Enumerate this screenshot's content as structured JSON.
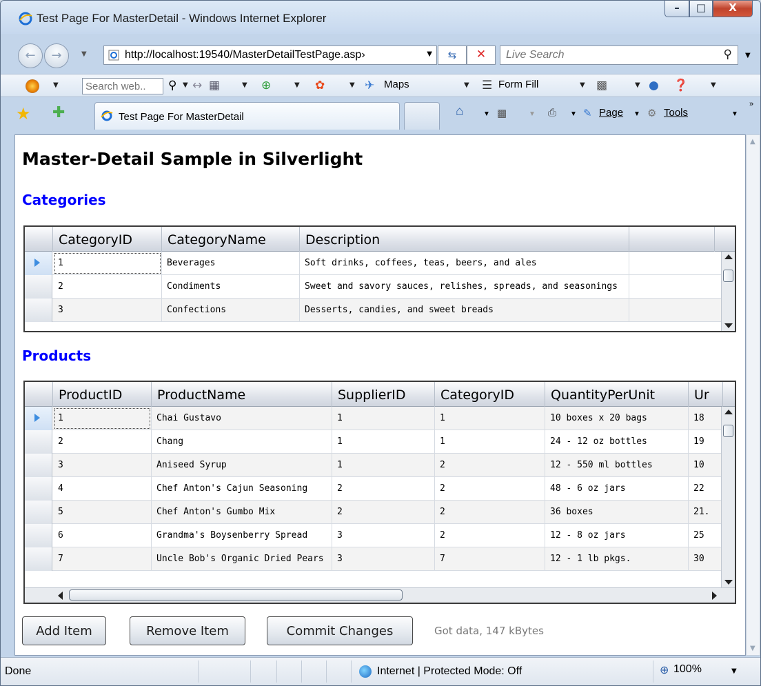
{
  "window": {
    "title": "Test Page For MasterDetail - Windows Internet Explorer",
    "min_glyph": "–",
    "max_glyph": "□",
    "close_glyph": "X"
  },
  "address": {
    "url": "http://localhost:19540/MasterDetailTestPage.asp›",
    "search_placeholder": "Live Search"
  },
  "toolbar": {
    "search_placeholder": "Search web..",
    "maps_label": "Maps",
    "formfill_label": "Form Fill"
  },
  "tabs": {
    "active_label": "Test Page For MasterDetail"
  },
  "commands": {
    "page_label": "Page",
    "tools_label": "Tools"
  },
  "page": {
    "title": "Master-Detail Sample in Silverlight",
    "categories_heading": "Categories",
    "products_heading": "Products",
    "status_text": "Got data, 147 kBytes"
  },
  "categories": {
    "columns": [
      "CategoryID",
      "CategoryName",
      "Description",
      ""
    ],
    "rows": [
      [
        "1",
        "Beverages",
        "Soft drinks, coffees, teas, beers, and ales"
      ],
      [
        "2",
        "Condiments",
        "Sweet and savory sauces, relishes, spreads, and seasonings"
      ],
      [
        "3",
        "Confections",
        "Desserts, candies, and sweet breads"
      ]
    ]
  },
  "products": {
    "columns": [
      "ProductID",
      "ProductName",
      "SupplierID",
      "CategoryID",
      "QuantityPerUnit",
      "Ur"
    ],
    "rows": [
      [
        "1",
        "Chai Gustavo",
        "1",
        "1",
        "10 boxes x 20 bags",
        "18"
      ],
      [
        "2",
        "Chang",
        "1",
        "1",
        "24 - 12 oz bottles",
        "19"
      ],
      [
        "3",
        "Aniseed Syrup",
        "1",
        "2",
        "12 - 550 ml bottles",
        "10"
      ],
      [
        "4",
        "Chef Anton's Cajun Seasoning",
        "2",
        "2",
        "48 - 6 oz jars",
        "22"
      ],
      [
        "5",
        "Chef Anton's Gumbo Mix",
        "2",
        "2",
        "36 boxes",
        "21."
      ],
      [
        "6",
        "Grandma's Boysenberry Spread",
        "3",
        "2",
        "12 - 8 oz jars",
        "25"
      ],
      [
        "7",
        "Uncle Bob's Organic Dried Pears",
        "3",
        "7",
        "12 - 1 lb pkgs.",
        "30"
      ]
    ]
  },
  "buttons": {
    "add": "Add Item",
    "remove": "Remove Item",
    "commit": "Commit Changes"
  },
  "statusbar": {
    "done": "Done",
    "zone": "Internet | Protected Mode: Off",
    "zoom": "100%"
  }
}
